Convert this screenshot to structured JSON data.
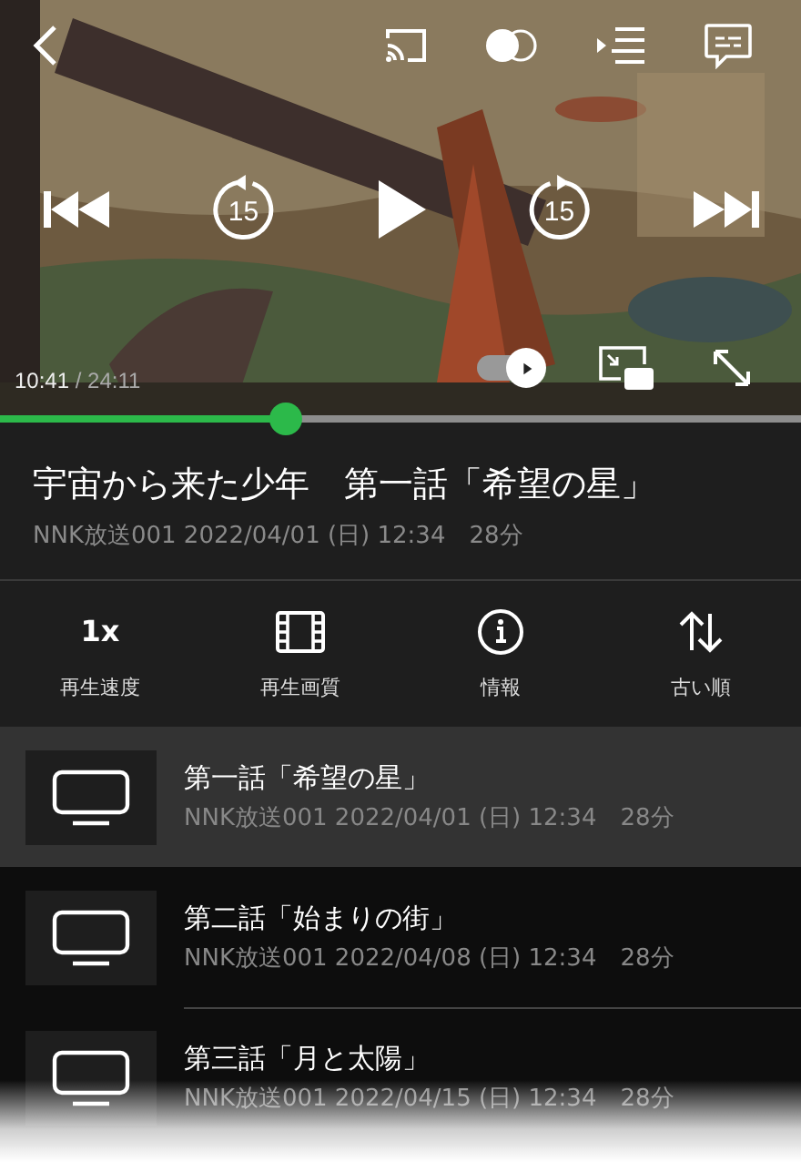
{
  "player": {
    "top_icons": [
      {
        "kind": "back"
      },
      {
        "kind": "cast"
      },
      {
        "kind": "blend"
      },
      {
        "kind": "playlist"
      },
      {
        "kind": "subtitles"
      }
    ],
    "transport": [
      {
        "kind": "prev"
      },
      {
        "kind": "rewind",
        "label": "15"
      },
      {
        "kind": "play"
      },
      {
        "kind": "forward",
        "label": "15"
      },
      {
        "kind": "next"
      }
    ],
    "elapsed": "10:41",
    "separator": "/",
    "duration": "24:11",
    "autoplay": {
      "on": true
    },
    "progress": {
      "level": 0.357
    }
  },
  "title": "宇宙から来た少年　第一話「希望の星」",
  "meta": "NNK放送001 2022/04/01 (日) 12:34　28分",
  "actions": [
    {
      "kind": "speed",
      "value": "1x",
      "label": "再生速度"
    },
    {
      "kind": "quality",
      "label": "再生画質"
    },
    {
      "kind": "info",
      "label": "情報"
    },
    {
      "kind": "sort",
      "label": "古い順"
    }
  ],
  "episodes": [
    {
      "title": "第一話「希望の星」",
      "meta": "NNK放送001 2022/04/01 (日) 12:34　28分",
      "selected": true
    },
    {
      "title": "第二話「始まりの街」",
      "meta": "NNK放送001 2022/04/08 (日) 12:34　28分",
      "selected": false
    },
    {
      "title": "第三話「月と太陽」",
      "meta": "NNK放送001 2022/04/15 (日) 12:34　28分",
      "selected": false
    }
  ]
}
